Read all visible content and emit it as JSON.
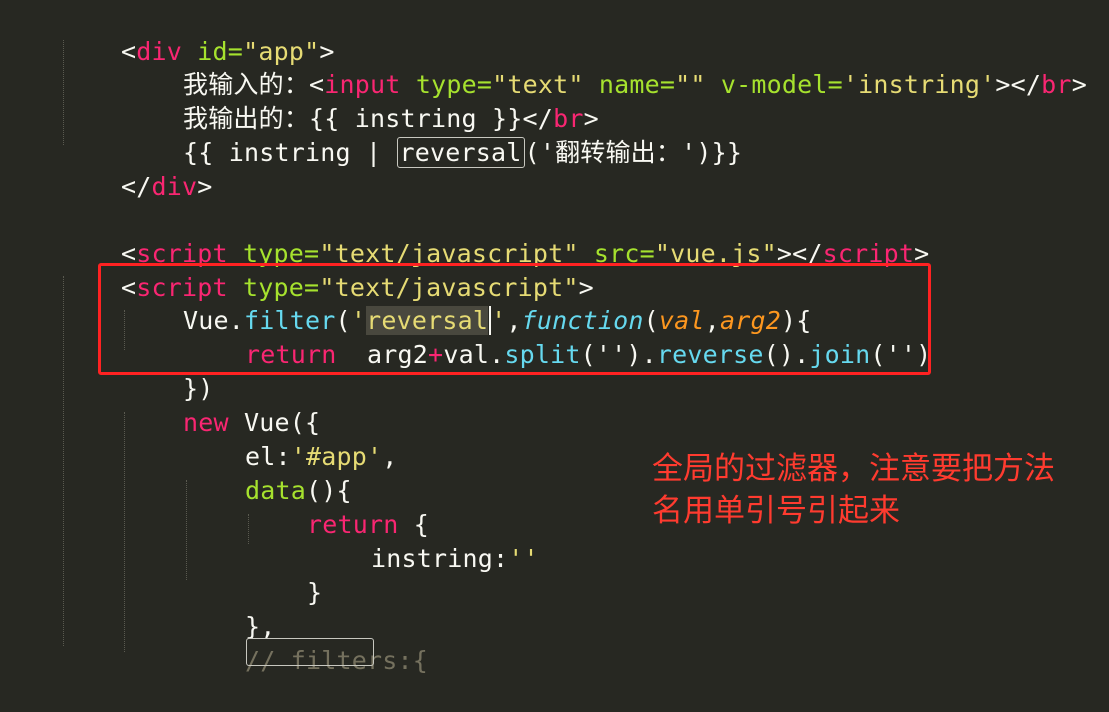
{
  "code": {
    "l1_open": "<",
    "l1_tag": "div",
    "l1_attr": " id=",
    "l1_val": "\"app\"",
    "l1_close": ">",
    "l2_label": "我输入的：",
    "l2_lt": "<",
    "l2_tag": "input",
    "l2_attr1": " type=",
    "l2_val1": "\"text\"",
    "l2_attr2": " name=",
    "l2_val2": "\"\"",
    "l2_attr3": " v-model=",
    "l2_val3": "'instring'",
    "l2_mid": "></",
    "l2_tag2": "br",
    "l2_end": ">",
    "l3_label": "我输出的：",
    "l3_expr": "{{ instring }}</",
    "l3_tag": "br",
    "l3_end": ">",
    "l4_start": "{{ instring | ",
    "l4_filter": "reversal",
    "l4_open": "('",
    "l4_arg": "翻转输出：",
    "l4_close": "')}}",
    "l5_open": "</",
    "l5_tag": "div",
    "l5_end": ">",
    "l7_open": "<",
    "l7_tag": "script",
    "l7_attr1": " type=",
    "l7_val1": "\"text/javascript\"",
    "l7_attr2": " src=",
    "l7_val2": "\"vue.js\"",
    "l7_mid": "></",
    "l7_tag2": "script",
    "l7_end": ">",
    "l8_open": "<",
    "l8_tag": "script",
    "l8_attr": " type=",
    "l8_val": "\"text/javascript\"",
    "l8_end": ">",
    "l9_obj": "Vue.",
    "l9_method": "filter",
    "l9_open": "(",
    "l9_q1": "'",
    "l9_name": "reversal",
    "l9_q2": "'",
    "l9_comma": ",",
    "l9_kw": "function",
    "l9_p_open": "(",
    "l9_p1": "val",
    "l9_p_comma": ",",
    "l9_p2": "arg2",
    "l9_p_close": "){",
    "l10_kw": "return",
    "l10_a": "  arg2",
    "l10_plus": "+",
    "l10_b": "val.",
    "l10_split": "split",
    "l10_c": "('').",
    "l10_reverse": "reverse",
    "l10_d": "().",
    "l10_join": "join",
    "l10_e": "('')",
    "l11": "})",
    "l12_kw": "new",
    "l12_rest": " Vue({",
    "l13_key": "el:",
    "l13_val": "'#app'",
    "l13_comma": ",",
    "l14_fn": "data",
    "l14_rest": "(){",
    "l15_kw": "return",
    "l15_rest": " {",
    "l16_key": "instring:",
    "l16_val": "''",
    "l17": "}",
    "l18": "},",
    "l19": "// filters:{"
  },
  "annotation": {
    "line1": "全局的过滤器，注意要把方法",
    "line2": "名用单引号引起来"
  },
  "colors": {
    "background": "#272822",
    "tag": "#f92672",
    "attribute": "#a6e22e",
    "string": "#e6db74",
    "function": "#66d9ef",
    "parameter": "#fd971f",
    "comment": "#75715e",
    "highlight_border": "#ff2222",
    "annotation_text": "#ff3b2f"
  }
}
